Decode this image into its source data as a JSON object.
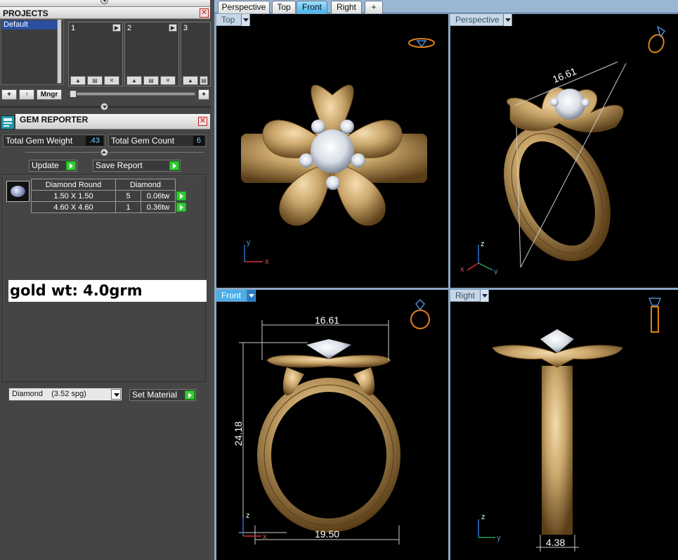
{
  "projects": {
    "title": "PROJECTS",
    "list_items": [
      "Default"
    ],
    "slots": [
      "1",
      "2",
      "3"
    ],
    "tools": [
      "+",
      "↑",
      "Mngr",
      "+"
    ]
  },
  "gem_reporter": {
    "title": "GEM REPORTER",
    "total_weight_label": "Total Gem Weight",
    "total_weight_value": ".43",
    "total_count_label": "Total Gem Count",
    "total_count_value": "6",
    "update_label": "Update",
    "save_report_label": "Save Report",
    "table": {
      "headers": [
        "Diamond Round",
        "Diamond"
      ],
      "rows": [
        {
          "size": "1.50 X 1.50",
          "count": "5",
          "weight": "0.06tw"
        },
        {
          "size": "4.60 X 4.60",
          "count": "1",
          "weight": "0.36tw"
        }
      ]
    },
    "note": "gold wt: 4.0grm",
    "material_value": "Diamond    (3.52 spg)",
    "set_material_label": "Set Material"
  },
  "viewport_tabs": [
    "Perspective",
    "Top",
    "Front",
    "Right",
    "+"
  ],
  "active_tab": "Front",
  "viewports": {
    "top": {
      "label": "Top",
      "axes": [
        "y",
        "x"
      ]
    },
    "perspective": {
      "label": "Perspective",
      "axes": [
        "z",
        "x",
        "y"
      ],
      "dimension": "16.61"
    },
    "front": {
      "label": "Front",
      "axes": [
        "z",
        "x"
      ],
      "dimensions": {
        "width": "16.61",
        "height": "24.18",
        "base": "19.50"
      }
    },
    "right": {
      "label": "Right",
      "axes": [
        "z",
        "y"
      ],
      "dimension": "4.38"
    }
  },
  "colors": {
    "gold": "#c9a56a",
    "gold_dark": "#7a5a2a",
    "accent": "#46b3ec",
    "indicator": "#e0801a"
  }
}
